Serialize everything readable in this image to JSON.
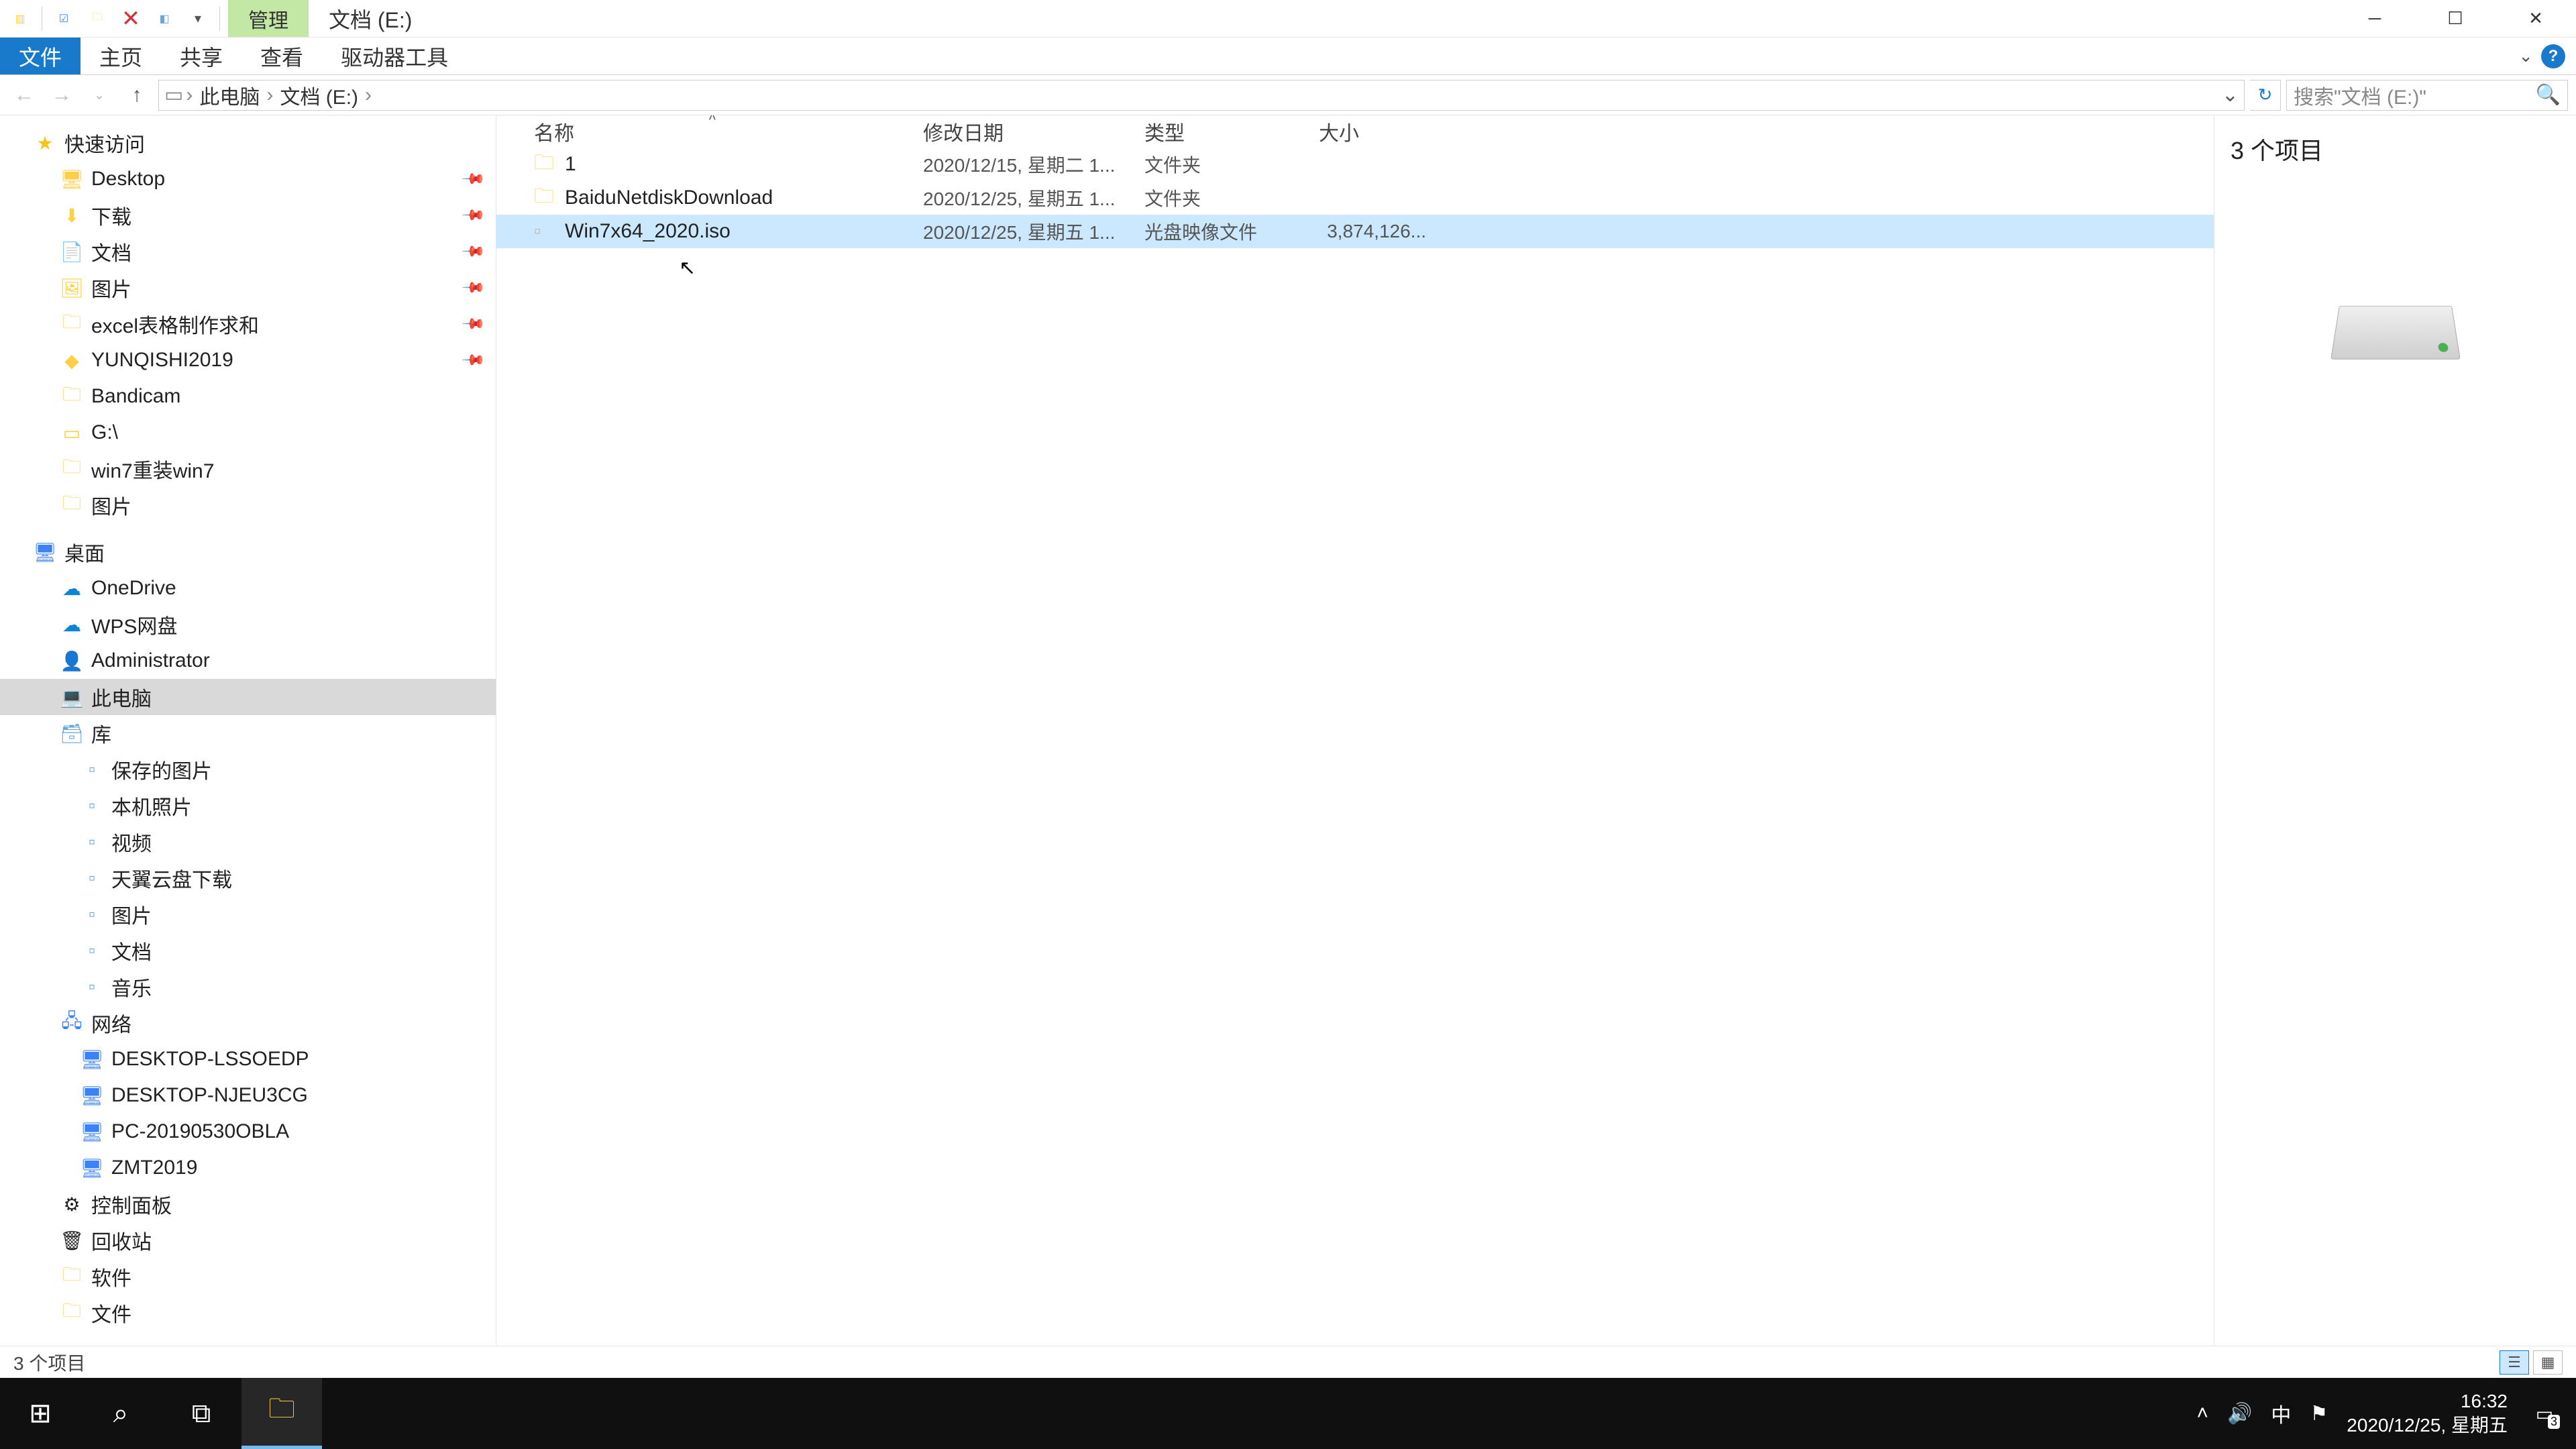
{
  "titlebar": {
    "contextual_tab": "管理",
    "window_title": "文档 (E:)"
  },
  "ribbon": {
    "file": "文件",
    "home": "主页",
    "share": "共享",
    "view": "查看",
    "drive_tools": "驱动器工具"
  },
  "breadcrumb": {
    "root": "此电脑",
    "drive": "文档 (E:)"
  },
  "search": {
    "placeholder": "搜索\"文档 (E:)\""
  },
  "tree": {
    "quick_access": "快速访问",
    "items_qa": [
      {
        "icon": "desktop",
        "label": "Desktop",
        "pin": true
      },
      {
        "icon": "down",
        "label": "下载",
        "pin": true
      },
      {
        "icon": "doc",
        "label": "文档",
        "pin": true
      },
      {
        "icon": "pic",
        "label": "图片",
        "pin": true
      },
      {
        "icon": "folder",
        "label": "excel表格制作求和",
        "pin": true
      },
      {
        "icon": "app",
        "label": "YUNQISHI2019",
        "pin": true
      },
      {
        "icon": "folder",
        "label": "Bandicam",
        "pin": false
      },
      {
        "icon": "drive",
        "label": "G:\\",
        "pin": false
      },
      {
        "icon": "folder",
        "label": "win7重装win7",
        "pin": false
      },
      {
        "icon": "folder",
        "label": "图片",
        "pin": false
      }
    ],
    "desktop": "桌面",
    "onedrive": "OneDrive",
    "wps": "WPS网盘",
    "admin": "Administrator",
    "thispc": "此电脑",
    "libraries": "库",
    "lib_items": [
      "保存的图片",
      "本机照片",
      "视频",
      "天翼云盘下载",
      "图片",
      "文档",
      "音乐"
    ],
    "network": "网络",
    "net_items": [
      "DESKTOP-LSSOEDP",
      "DESKTOP-NJEU3CG",
      "PC-20190530OBLA",
      "ZMT2019"
    ],
    "control_panel": "控制面板",
    "recycle": "回收站",
    "soft": "软件",
    "files": "文件"
  },
  "columns": {
    "name": "名称",
    "date": "修改日期",
    "type": "类型",
    "size": "大小"
  },
  "rows": [
    {
      "icon": "folder",
      "name": "1",
      "date": "2020/12/15, 星期二 1...",
      "type": "文件夹",
      "size": "",
      "selected": false
    },
    {
      "icon": "folder",
      "name": "BaiduNetdiskDownload",
      "date": "2020/12/25, 星期五 1...",
      "type": "文件夹",
      "size": "",
      "selected": false
    },
    {
      "icon": "iso",
      "name": "Win7x64_2020.iso",
      "date": "2020/12/25, 星期五 1...",
      "type": "光盘映像文件",
      "size": "3,874,126...",
      "selected": true
    }
  ],
  "details": {
    "count": "3 个项目"
  },
  "statusbar": {
    "text": "3 个项目"
  },
  "taskbar": {
    "time": "16:32",
    "date": "2020/12/25, 星期五",
    "ime": "中",
    "notif_count": "3"
  }
}
